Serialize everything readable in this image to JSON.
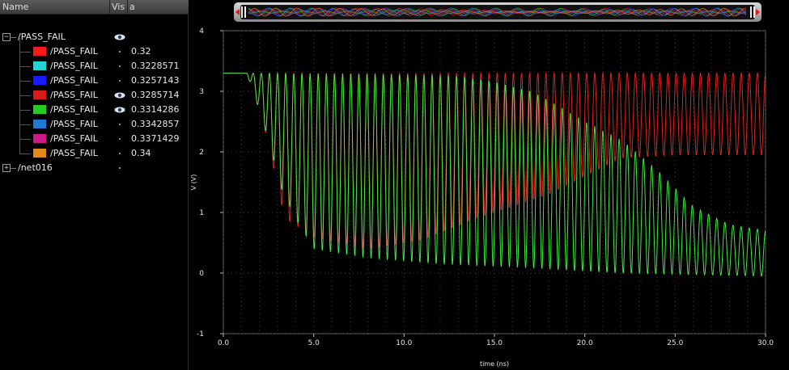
{
  "legend_header": {
    "name": "Name",
    "vis": "Vis",
    "a": "a"
  },
  "legend_groups": [
    {
      "name": "/PASS_FAIL",
      "toggle": "−",
      "eye": true
    },
    {
      "name": "/net016",
      "toggle": "+",
      "eye": false
    }
  ],
  "legend_items": [
    {
      "name": "/PASS_FAIL",
      "value": "0.32",
      "color": "#ff1a1a",
      "eye": false
    },
    {
      "name": "/PASS_FAIL",
      "value": "0.3228571",
      "color": "#22d3d3",
      "eye": false
    },
    {
      "name": "/PASS_FAIL",
      "value": "0.3257143",
      "color": "#1a1aff",
      "eye": false
    },
    {
      "name": "/PASS_FAIL",
      "value": "0.3285714",
      "color": "#d41a1a",
      "eye": true
    },
    {
      "name": "/PASS_FAIL",
      "value": "0.3314286",
      "color": "#22cc22",
      "eye": true
    },
    {
      "name": "/PASS_FAIL",
      "value": "0.3342857",
      "color": "#1e7ad6",
      "eye": false
    },
    {
      "name": "/PASS_FAIL",
      "value": "0.3371429",
      "color": "#cc1a8a",
      "eye": false
    },
    {
      "name": "/PASS_FAIL",
      "value": "0.34",
      "color": "#e08a1a",
      "eye": false
    }
  ],
  "chart_data": {
    "type": "line",
    "title": "",
    "xlabel": "time (ns)",
    "ylabel": "V (V)",
    "xlim": [
      0,
      30
    ],
    "ylim": [
      -1,
      4
    ],
    "xticks": [
      "0.0",
      "5.0",
      "10.0",
      "15.0",
      "20.0",
      "25.0",
      "30.0"
    ],
    "yticks": [
      "-1",
      "0",
      "1",
      "2",
      "3",
      "4"
    ],
    "grid": true,
    "period_ns": 0.45,
    "series": [
      {
        "name": "/PASS_FAIL 0.3285714",
        "color": "#e02020",
        "start": 1.2,
        "high": [
          [
            0,
            3.3
          ],
          [
            30,
            3.3
          ]
        ],
        "low": [
          [
            1.3,
            3.3
          ],
          [
            2.2,
            2.5
          ],
          [
            3.4,
            0.9
          ],
          [
            5,
            0.6
          ],
          [
            8,
            0.4
          ],
          [
            11,
            0.55
          ],
          [
            14,
            0.9
          ],
          [
            16,
            1.1
          ],
          [
            18,
            1.3
          ],
          [
            20,
            1.6
          ],
          [
            22,
            1.9
          ],
          [
            25,
            1.95
          ],
          [
            30,
            1.95
          ]
        ]
      },
      {
        "name": "/PASS_FAIL 0.3314286",
        "color": "#3ee83e",
        "start": 1.2,
        "high": [
          [
            0,
            3.3
          ],
          [
            9,
            3.28
          ],
          [
            13,
            3.25
          ],
          [
            15,
            3.15
          ],
          [
            17,
            3.0
          ],
          [
            18,
            2.85
          ],
          [
            20,
            2.5
          ],
          [
            22,
            2.2
          ],
          [
            24,
            1.7
          ],
          [
            26,
            1.1
          ],
          [
            28,
            0.8
          ],
          [
            30,
            0.7
          ]
        ],
        "low": [
          [
            1.3,
            3.3
          ],
          [
            2.2,
            2.5
          ],
          [
            3.2,
            1.4
          ],
          [
            4,
            0.9
          ],
          [
            5,
            0.4
          ],
          [
            8,
            0.25
          ],
          [
            12,
            0.15
          ],
          [
            16,
            0.1
          ],
          [
            22,
            0.0
          ],
          [
            30,
            -0.05
          ]
        ]
      }
    ]
  }
}
